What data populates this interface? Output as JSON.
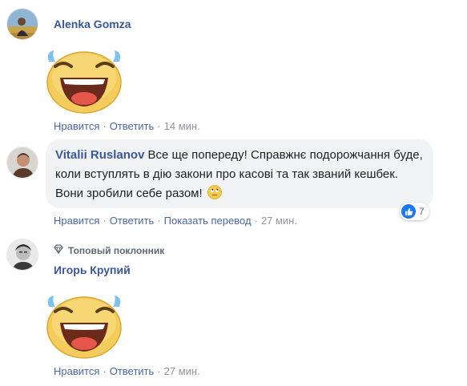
{
  "comments": [
    {
      "author": "Alenka Gomza",
      "actions": {
        "like": "Нравится",
        "reply": "Ответить",
        "time": "14 мин."
      }
    },
    {
      "author": "Vitalii Ruslanov",
      "text": "Все ще попереду! Справжнє подорожчання буде, коли вступлять в дію закони про касові та так званий кешбек. Вони зробили себе разом!",
      "reaction_count": "7",
      "actions": {
        "like": "Нравится",
        "reply": "Ответить",
        "translate": "Показать перевод",
        "time": "27 мин."
      }
    },
    {
      "badge": "Топовый поклонник",
      "author": "Игорь Крупий",
      "actions": {
        "like": "Нравится",
        "reply": "Ответить",
        "time": "27 мин."
      }
    }
  ],
  "colors": {
    "name_link": "#385898",
    "action_link": "#4b67a1",
    "meta": "#90949c",
    "bubble_bg": "#f2f3f5",
    "like_blue": "#1877f2"
  },
  "icons": [
    "laughing-sticker-icon",
    "eye-roll-emoji-icon",
    "like-thumb-icon",
    "top-fan-diamond-icon"
  ]
}
